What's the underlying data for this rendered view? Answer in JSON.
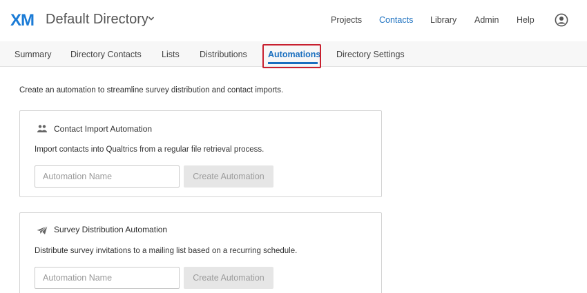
{
  "header": {
    "logo": "XM",
    "directory_title": "Default Directory",
    "nav": [
      "Projects",
      "Contacts",
      "Library",
      "Admin",
      "Help"
    ],
    "active_nav": "Contacts"
  },
  "subnav": {
    "tabs": [
      "Summary",
      "Directory Contacts",
      "Lists",
      "Distributions",
      "Automations",
      "Directory Settings"
    ],
    "active_tab": "Automations"
  },
  "intro": "Create an automation to streamline survey distribution and contact imports.",
  "cards": [
    {
      "icon": "people-icon",
      "title": "Contact Import Automation",
      "description": "Import contacts into Qualtrics from a regular file retrieval process.",
      "input_value": "",
      "input_placeholder": "Automation Name",
      "button_label": "Create Automation"
    },
    {
      "icon": "paper-plane-icon",
      "title": "Survey Distribution Automation",
      "description": "Distribute survey invitations to a mailing list based on a recurring schedule.",
      "input_value": "",
      "input_placeholder": "Automation Name",
      "button_label": "Create Automation"
    }
  ],
  "colors": {
    "accent": "#1a6fbf",
    "logo": "#1a7bd6",
    "highlight": "#c8202f",
    "disabled_button": "#e6e6e6"
  }
}
